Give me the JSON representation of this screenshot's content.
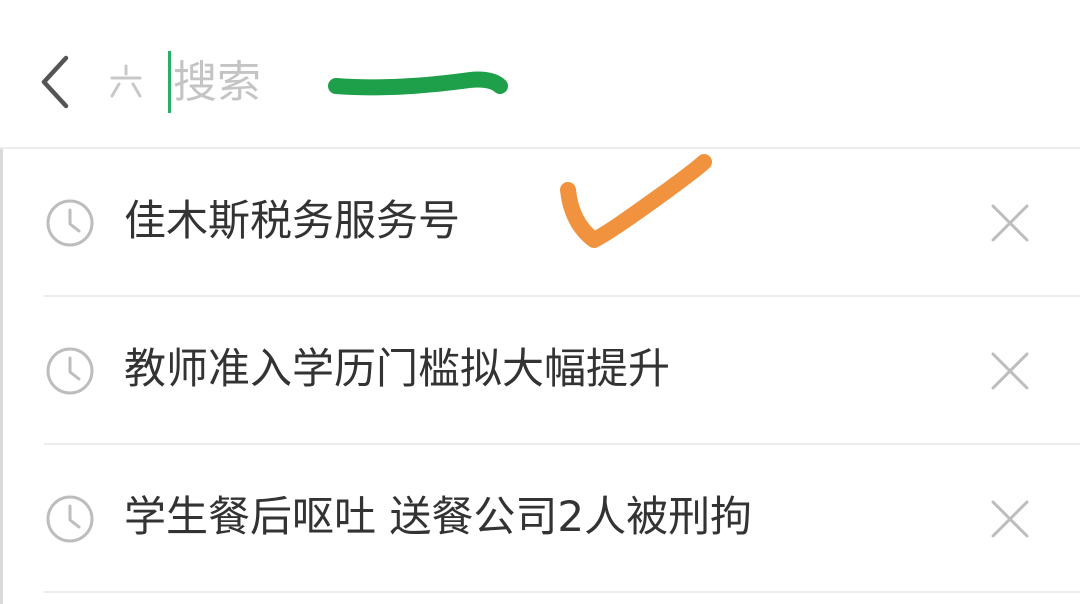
{
  "search": {
    "placeholder": "搜索",
    "value": "",
    "type_icon": "six-dots-icon"
  },
  "header": {
    "back_icon": "chevron-left-icon"
  },
  "history": {
    "items": [
      {
        "label": "佳木斯税务服务号",
        "icon": "clock-icon",
        "remove_icon": "close-icon"
      },
      {
        "label": "教师准入学历门槛拟大幅提升",
        "icon": "clock-icon",
        "remove_icon": "close-icon"
      },
      {
        "label": "学生餐后呕吐 送餐公司2人被刑拘",
        "icon": "clock-icon",
        "remove_icon": "close-icon"
      }
    ]
  },
  "annotations": {
    "stroke_color": "#1ea04a",
    "check_color": "#f0923e"
  },
  "colors": {
    "text": "#333333",
    "placeholder": "#c4c4c4",
    "caret": "#2aae67",
    "icon_gray": "#bdbdbd",
    "divider": "#ececec"
  }
}
